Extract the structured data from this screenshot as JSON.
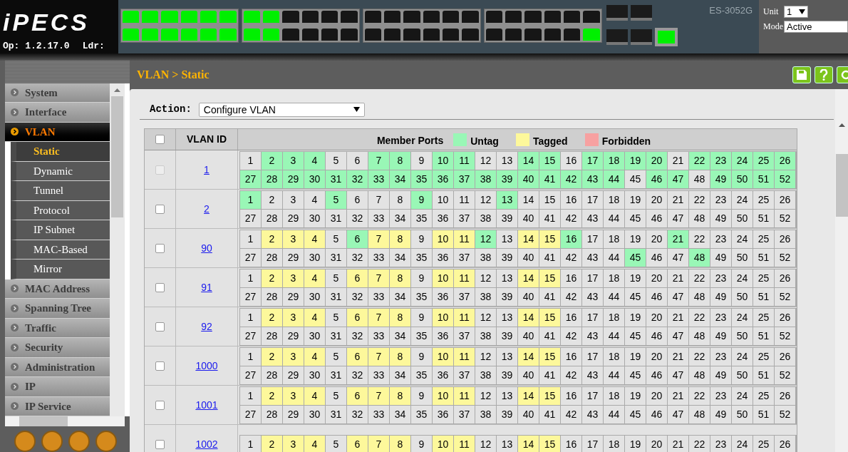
{
  "header": {
    "logo": "iPECS",
    "op_version": "Op: 1.2.17.0",
    "loader_label": "Ldr:",
    "model": "ES-3052G",
    "unit": {
      "label": "Unit",
      "value": "1"
    },
    "mode": {
      "label": "Mode",
      "value": "Active"
    },
    "panel": {
      "groups": [
        {
          "top": [
            true,
            true,
            true,
            true,
            true,
            true
          ],
          "bottom": [
            true,
            true,
            true,
            true,
            true,
            true
          ]
        },
        {
          "top": [
            true,
            true,
            false,
            false,
            false,
            false
          ],
          "bottom": [
            true,
            true,
            false,
            false,
            false,
            false
          ]
        },
        {
          "top": [
            false,
            false,
            false,
            false,
            false,
            false
          ],
          "bottom": [
            false,
            false,
            false,
            false,
            false,
            false
          ]
        },
        {
          "top": [
            false,
            false,
            false,
            false,
            false,
            false
          ],
          "bottom": [
            false,
            false,
            false,
            false,
            false,
            true
          ]
        }
      ],
      "mgmt_link": true
    }
  },
  "sidebar": {
    "items": [
      {
        "label": "System",
        "kind": "section",
        "selected": false
      },
      {
        "label": "Interface",
        "kind": "section",
        "selected": false
      },
      {
        "label": "VLAN",
        "kind": "section",
        "selected": true
      },
      {
        "label": "Static",
        "kind": "sub",
        "selected": true
      },
      {
        "label": "Dynamic",
        "kind": "sub",
        "selected": false
      },
      {
        "label": "Tunnel",
        "kind": "sub",
        "selected": false
      },
      {
        "label": "Protocol",
        "kind": "sub",
        "selected": false
      },
      {
        "label": "IP Subnet",
        "kind": "sub",
        "selected": false
      },
      {
        "label": "MAC-Based",
        "kind": "sub",
        "selected": false
      },
      {
        "label": "Mirror",
        "kind": "sub",
        "selected": false
      },
      {
        "label": "MAC Address",
        "kind": "section",
        "selected": false
      },
      {
        "label": "Spanning Tree",
        "kind": "section",
        "selected": false
      },
      {
        "label": "Traffic",
        "kind": "section",
        "selected": false
      },
      {
        "label": "Security",
        "kind": "section",
        "selected": false
      },
      {
        "label": "Administration",
        "kind": "section",
        "selected": false
      },
      {
        "label": "IP",
        "kind": "section",
        "selected": false
      },
      {
        "label": "IP Service",
        "kind": "section",
        "selected": false
      }
    ]
  },
  "breadcrumb": "VLAN > Static",
  "action": {
    "label": "Action:",
    "value": "Configure VLAN"
  },
  "table": {
    "columns": [
      "VLAN ID",
      "Member Ports"
    ],
    "select_all_checked": false,
    "legend": [
      {
        "label": "Untag",
        "color": "#99f7b6"
      },
      {
        "label": "Tagged",
        "color": "#fdf89b"
      },
      {
        "label": "Forbidden",
        "color": "#f7a1a1"
      }
    ],
    "vlans": [
      {
        "id": "1",
        "checkbox_disabled": true,
        "ports": [
          {
            "port": "1",
            "kind": "none"
          },
          {
            "port": "2",
            "kind": "untag"
          },
          {
            "port": "3",
            "kind": "untag"
          },
          {
            "port": "4",
            "kind": "untag"
          },
          {
            "port": "5",
            "kind": "none"
          },
          {
            "port": "6",
            "kind": "none"
          },
          {
            "port": "7",
            "kind": "untag"
          },
          {
            "port": "8",
            "kind": "untag"
          },
          {
            "port": "9",
            "kind": "none"
          },
          {
            "port": "10",
            "kind": "untag"
          },
          {
            "port": "11",
            "kind": "untag"
          },
          {
            "port": "12",
            "kind": "none"
          },
          {
            "port": "13",
            "kind": "none"
          },
          {
            "port": "14",
            "kind": "untag"
          },
          {
            "port": "15",
            "kind": "untag"
          },
          {
            "port": "16",
            "kind": "none"
          },
          {
            "port": "17",
            "kind": "untag"
          },
          {
            "port": "18",
            "kind": "untag"
          },
          {
            "port": "19",
            "kind": "untag"
          },
          {
            "port": "20",
            "kind": "untag"
          },
          {
            "port": "21",
            "kind": "none"
          },
          {
            "port": "22",
            "kind": "untag"
          },
          {
            "port": "23",
            "kind": "untag"
          },
          {
            "port": "24",
            "kind": "untag"
          },
          {
            "port": "25",
            "kind": "untag"
          },
          {
            "port": "26",
            "kind": "untag"
          },
          {
            "port": "27",
            "kind": "untag"
          },
          {
            "port": "28",
            "kind": "untag"
          },
          {
            "port": "29",
            "kind": "untag"
          },
          {
            "port": "30",
            "kind": "untag"
          },
          {
            "port": "31",
            "kind": "untag"
          },
          {
            "port": "32",
            "kind": "untag"
          },
          {
            "port": "33",
            "kind": "untag"
          },
          {
            "port": "34",
            "kind": "untag"
          },
          {
            "port": "35",
            "kind": "untag"
          },
          {
            "port": "36",
            "kind": "untag"
          },
          {
            "port": "37",
            "kind": "untag"
          },
          {
            "port": "38",
            "kind": "untag"
          },
          {
            "port": "39",
            "kind": "untag"
          },
          {
            "port": "40",
            "kind": "untag"
          },
          {
            "port": "41",
            "kind": "untag"
          },
          {
            "port": "42",
            "kind": "untag"
          },
          {
            "port": "43",
            "kind": "untag"
          },
          {
            "port": "44",
            "kind": "untag"
          },
          {
            "port": "45",
            "kind": "none"
          },
          {
            "port": "46",
            "kind": "untag"
          },
          {
            "port": "47",
            "kind": "untag"
          },
          {
            "port": "48",
            "kind": "none"
          },
          {
            "port": "49",
            "kind": "untag"
          },
          {
            "port": "50",
            "kind": "untag"
          },
          {
            "port": "51",
            "kind": "untag"
          },
          {
            "port": "52",
            "kind": "untag"
          }
        ]
      },
      {
        "id": "2",
        "checkbox_disabled": false,
        "ports": [
          {
            "port": "1",
            "kind": "untag"
          },
          {
            "port": "2",
            "kind": "none"
          },
          {
            "port": "3",
            "kind": "none"
          },
          {
            "port": "4",
            "kind": "none"
          },
          {
            "port": "5",
            "kind": "untag"
          },
          {
            "port": "6",
            "kind": "none"
          },
          {
            "port": "7",
            "kind": "none"
          },
          {
            "port": "8",
            "kind": "none"
          },
          {
            "port": "9",
            "kind": "untag"
          },
          {
            "port": "10",
            "kind": "none"
          },
          {
            "port": "11",
            "kind": "none"
          },
          {
            "port": "12",
            "kind": "none"
          },
          {
            "port": "13",
            "kind": "untag"
          },
          {
            "port": "14",
            "kind": "none"
          },
          {
            "port": "15",
            "kind": "none"
          },
          {
            "port": "16",
            "kind": "none"
          },
          {
            "port": "17",
            "kind": "none"
          },
          {
            "port": "18",
            "kind": "none"
          },
          {
            "port": "19",
            "kind": "none"
          },
          {
            "port": "20",
            "kind": "none"
          },
          {
            "port": "21",
            "kind": "none"
          },
          {
            "port": "22",
            "kind": "none"
          },
          {
            "port": "23",
            "kind": "none"
          },
          {
            "port": "24",
            "kind": "none"
          },
          {
            "port": "25",
            "kind": "none"
          },
          {
            "port": "26",
            "kind": "none"
          },
          {
            "port": "27",
            "kind": "none"
          },
          {
            "port": "28",
            "kind": "none"
          },
          {
            "port": "29",
            "kind": "none"
          },
          {
            "port": "30",
            "kind": "none"
          },
          {
            "port": "31",
            "kind": "none"
          },
          {
            "port": "32",
            "kind": "none"
          },
          {
            "port": "33",
            "kind": "none"
          },
          {
            "port": "34",
            "kind": "none"
          },
          {
            "port": "35",
            "kind": "none"
          },
          {
            "port": "36",
            "kind": "none"
          },
          {
            "port": "37",
            "kind": "none"
          },
          {
            "port": "38",
            "kind": "none"
          },
          {
            "port": "39",
            "kind": "none"
          },
          {
            "port": "40",
            "kind": "none"
          },
          {
            "port": "41",
            "kind": "none"
          },
          {
            "port": "42",
            "kind": "none"
          },
          {
            "port": "43",
            "kind": "none"
          },
          {
            "port": "44",
            "kind": "none"
          },
          {
            "port": "45",
            "kind": "none"
          },
          {
            "port": "46",
            "kind": "none"
          },
          {
            "port": "47",
            "kind": "none"
          },
          {
            "port": "48",
            "kind": "none"
          },
          {
            "port": "49",
            "kind": "none"
          },
          {
            "port": "50",
            "kind": "none"
          },
          {
            "port": "51",
            "kind": "none"
          },
          {
            "port": "52",
            "kind": "none"
          }
        ]
      },
      {
        "id": "90",
        "checkbox_disabled": false,
        "ports": [
          {
            "port": "1",
            "kind": "none"
          },
          {
            "port": "2",
            "kind": "tagged"
          },
          {
            "port": "3",
            "kind": "tagged"
          },
          {
            "port": "4",
            "kind": "tagged"
          },
          {
            "port": "5",
            "kind": "none"
          },
          {
            "port": "6",
            "kind": "untag"
          },
          {
            "port": "7",
            "kind": "tagged"
          },
          {
            "port": "8",
            "kind": "tagged"
          },
          {
            "port": "9",
            "kind": "none"
          },
          {
            "port": "10",
            "kind": "tagged"
          },
          {
            "port": "11",
            "kind": "tagged"
          },
          {
            "port": "12",
            "kind": "untag"
          },
          {
            "port": "13",
            "kind": "none"
          },
          {
            "port": "14",
            "kind": "tagged"
          },
          {
            "port": "15",
            "kind": "tagged"
          },
          {
            "port": "16",
            "kind": "untag"
          },
          {
            "port": "17",
            "kind": "none"
          },
          {
            "port": "18",
            "kind": "none"
          },
          {
            "port": "19",
            "kind": "none"
          },
          {
            "port": "20",
            "kind": "none"
          },
          {
            "port": "21",
            "kind": "untag"
          },
          {
            "port": "22",
            "kind": "none"
          },
          {
            "port": "23",
            "kind": "none"
          },
          {
            "port": "24",
            "kind": "none"
          },
          {
            "port": "25",
            "kind": "none"
          },
          {
            "port": "26",
            "kind": "none"
          },
          {
            "port": "27",
            "kind": "none"
          },
          {
            "port": "28",
            "kind": "none"
          },
          {
            "port": "29",
            "kind": "none"
          },
          {
            "port": "30",
            "kind": "none"
          },
          {
            "port": "31",
            "kind": "none"
          },
          {
            "port": "32",
            "kind": "none"
          },
          {
            "port": "33",
            "kind": "none"
          },
          {
            "port": "34",
            "kind": "none"
          },
          {
            "port": "35",
            "kind": "none"
          },
          {
            "port": "36",
            "kind": "none"
          },
          {
            "port": "37",
            "kind": "none"
          },
          {
            "port": "38",
            "kind": "none"
          },
          {
            "port": "39",
            "kind": "none"
          },
          {
            "port": "40",
            "kind": "none"
          },
          {
            "port": "41",
            "kind": "none"
          },
          {
            "port": "42",
            "kind": "none"
          },
          {
            "port": "43",
            "kind": "none"
          },
          {
            "port": "44",
            "kind": "none"
          },
          {
            "port": "45",
            "kind": "untag"
          },
          {
            "port": "46",
            "kind": "none"
          },
          {
            "port": "47",
            "kind": "none"
          },
          {
            "port": "48",
            "kind": "untag"
          },
          {
            "port": "49",
            "kind": "none"
          },
          {
            "port": "50",
            "kind": "none"
          },
          {
            "port": "51",
            "kind": "none"
          },
          {
            "port": "52",
            "kind": "none"
          }
        ]
      },
      {
        "id": "91",
        "checkbox_disabled": false,
        "ports": [
          {
            "port": "1",
            "kind": "none"
          },
          {
            "port": "2",
            "kind": "tagged"
          },
          {
            "port": "3",
            "kind": "tagged"
          },
          {
            "port": "4",
            "kind": "tagged"
          },
          {
            "port": "5",
            "kind": "none"
          },
          {
            "port": "6",
            "kind": "tagged"
          },
          {
            "port": "7",
            "kind": "tagged"
          },
          {
            "port": "8",
            "kind": "tagged"
          },
          {
            "port": "9",
            "kind": "none"
          },
          {
            "port": "10",
            "kind": "tagged"
          },
          {
            "port": "11",
            "kind": "tagged"
          },
          {
            "port": "12",
            "kind": "none"
          },
          {
            "port": "13",
            "kind": "none"
          },
          {
            "port": "14",
            "kind": "tagged"
          },
          {
            "port": "15",
            "kind": "tagged"
          },
          {
            "port": "16",
            "kind": "none"
          },
          {
            "port": "17",
            "kind": "none"
          },
          {
            "port": "18",
            "kind": "none"
          },
          {
            "port": "19",
            "kind": "none"
          },
          {
            "port": "20",
            "kind": "none"
          },
          {
            "port": "21",
            "kind": "none"
          },
          {
            "port": "22",
            "kind": "none"
          },
          {
            "port": "23",
            "kind": "none"
          },
          {
            "port": "24",
            "kind": "none"
          },
          {
            "port": "25",
            "kind": "none"
          },
          {
            "port": "26",
            "kind": "none"
          },
          {
            "port": "27",
            "kind": "none"
          },
          {
            "port": "28",
            "kind": "none"
          },
          {
            "port": "29",
            "kind": "none"
          },
          {
            "port": "30",
            "kind": "none"
          },
          {
            "port": "31",
            "kind": "none"
          },
          {
            "port": "32",
            "kind": "none"
          },
          {
            "port": "33",
            "kind": "none"
          },
          {
            "port": "34",
            "kind": "none"
          },
          {
            "port": "35",
            "kind": "none"
          },
          {
            "port": "36",
            "kind": "none"
          },
          {
            "port": "37",
            "kind": "none"
          },
          {
            "port": "38",
            "kind": "none"
          },
          {
            "port": "39",
            "kind": "none"
          },
          {
            "port": "40",
            "kind": "none"
          },
          {
            "port": "41",
            "kind": "none"
          },
          {
            "port": "42",
            "kind": "none"
          },
          {
            "port": "43",
            "kind": "none"
          },
          {
            "port": "44",
            "kind": "none"
          },
          {
            "port": "45",
            "kind": "none"
          },
          {
            "port": "46",
            "kind": "none"
          },
          {
            "port": "47",
            "kind": "none"
          },
          {
            "port": "48",
            "kind": "none"
          },
          {
            "port": "49",
            "kind": "none"
          },
          {
            "port": "50",
            "kind": "none"
          },
          {
            "port": "51",
            "kind": "none"
          },
          {
            "port": "52",
            "kind": "none"
          }
        ]
      },
      {
        "id": "92",
        "checkbox_disabled": false,
        "ports": [
          {
            "port": "1",
            "kind": "none"
          },
          {
            "port": "2",
            "kind": "tagged"
          },
          {
            "port": "3",
            "kind": "tagged"
          },
          {
            "port": "4",
            "kind": "tagged"
          },
          {
            "port": "5",
            "kind": "none"
          },
          {
            "port": "6",
            "kind": "tagged"
          },
          {
            "port": "7",
            "kind": "tagged"
          },
          {
            "port": "8",
            "kind": "tagged"
          },
          {
            "port": "9",
            "kind": "none"
          },
          {
            "port": "10",
            "kind": "tagged"
          },
          {
            "port": "11",
            "kind": "tagged"
          },
          {
            "port": "12",
            "kind": "none"
          },
          {
            "port": "13",
            "kind": "none"
          },
          {
            "port": "14",
            "kind": "tagged"
          },
          {
            "port": "15",
            "kind": "tagged"
          },
          {
            "port": "16",
            "kind": "none"
          },
          {
            "port": "17",
            "kind": "none"
          },
          {
            "port": "18",
            "kind": "none"
          },
          {
            "port": "19",
            "kind": "none"
          },
          {
            "port": "20",
            "kind": "none"
          },
          {
            "port": "21",
            "kind": "none"
          },
          {
            "port": "22",
            "kind": "none"
          },
          {
            "port": "23",
            "kind": "none"
          },
          {
            "port": "24",
            "kind": "none"
          },
          {
            "port": "25",
            "kind": "none"
          },
          {
            "port": "26",
            "kind": "none"
          },
          {
            "port": "27",
            "kind": "none"
          },
          {
            "port": "28",
            "kind": "none"
          },
          {
            "port": "29",
            "kind": "none"
          },
          {
            "port": "30",
            "kind": "none"
          },
          {
            "port": "31",
            "kind": "none"
          },
          {
            "port": "32",
            "kind": "none"
          },
          {
            "port": "33",
            "kind": "none"
          },
          {
            "port": "34",
            "kind": "none"
          },
          {
            "port": "35",
            "kind": "none"
          },
          {
            "port": "36",
            "kind": "none"
          },
          {
            "port": "37",
            "kind": "none"
          },
          {
            "port": "38",
            "kind": "none"
          },
          {
            "port": "39",
            "kind": "none"
          },
          {
            "port": "40",
            "kind": "none"
          },
          {
            "port": "41",
            "kind": "none"
          },
          {
            "port": "42",
            "kind": "none"
          },
          {
            "port": "43",
            "kind": "none"
          },
          {
            "port": "44",
            "kind": "none"
          },
          {
            "port": "45",
            "kind": "none"
          },
          {
            "port": "46",
            "kind": "none"
          },
          {
            "port": "47",
            "kind": "none"
          },
          {
            "port": "48",
            "kind": "none"
          },
          {
            "port": "49",
            "kind": "none"
          },
          {
            "port": "50",
            "kind": "none"
          },
          {
            "port": "51",
            "kind": "none"
          },
          {
            "port": "52",
            "kind": "none"
          }
        ]
      },
      {
        "id": "1000",
        "checkbox_disabled": false,
        "ports": [
          {
            "port": "1",
            "kind": "none"
          },
          {
            "port": "2",
            "kind": "tagged"
          },
          {
            "port": "3",
            "kind": "tagged"
          },
          {
            "port": "4",
            "kind": "tagged"
          },
          {
            "port": "5",
            "kind": "none"
          },
          {
            "port": "6",
            "kind": "tagged"
          },
          {
            "port": "7",
            "kind": "tagged"
          },
          {
            "port": "8",
            "kind": "tagged"
          },
          {
            "port": "9",
            "kind": "none"
          },
          {
            "port": "10",
            "kind": "tagged"
          },
          {
            "port": "11",
            "kind": "tagged"
          },
          {
            "port": "12",
            "kind": "none"
          },
          {
            "port": "13",
            "kind": "none"
          },
          {
            "port": "14",
            "kind": "tagged"
          },
          {
            "port": "15",
            "kind": "tagged"
          },
          {
            "port": "16",
            "kind": "none"
          },
          {
            "port": "17",
            "kind": "none"
          },
          {
            "port": "18",
            "kind": "none"
          },
          {
            "port": "19",
            "kind": "none"
          },
          {
            "port": "20",
            "kind": "none"
          },
          {
            "port": "21",
            "kind": "none"
          },
          {
            "port": "22",
            "kind": "none"
          },
          {
            "port": "23",
            "kind": "none"
          },
          {
            "port": "24",
            "kind": "none"
          },
          {
            "port": "25",
            "kind": "none"
          },
          {
            "port": "26",
            "kind": "none"
          },
          {
            "port": "27",
            "kind": "none"
          },
          {
            "port": "28",
            "kind": "none"
          },
          {
            "port": "29",
            "kind": "none"
          },
          {
            "port": "30",
            "kind": "none"
          },
          {
            "port": "31",
            "kind": "none"
          },
          {
            "port": "32",
            "kind": "none"
          },
          {
            "port": "33",
            "kind": "none"
          },
          {
            "port": "34",
            "kind": "none"
          },
          {
            "port": "35",
            "kind": "none"
          },
          {
            "port": "36",
            "kind": "none"
          },
          {
            "port": "37",
            "kind": "none"
          },
          {
            "port": "38",
            "kind": "none"
          },
          {
            "port": "39",
            "kind": "none"
          },
          {
            "port": "40",
            "kind": "none"
          },
          {
            "port": "41",
            "kind": "none"
          },
          {
            "port": "42",
            "kind": "none"
          },
          {
            "port": "43",
            "kind": "none"
          },
          {
            "port": "44",
            "kind": "none"
          },
          {
            "port": "45",
            "kind": "none"
          },
          {
            "port": "46",
            "kind": "none"
          },
          {
            "port": "47",
            "kind": "none"
          },
          {
            "port": "48",
            "kind": "none"
          },
          {
            "port": "49",
            "kind": "none"
          },
          {
            "port": "50",
            "kind": "none"
          },
          {
            "port": "51",
            "kind": "none"
          },
          {
            "port": "52",
            "kind": "none"
          }
        ]
      },
      {
        "id": "1001",
        "checkbox_disabled": false,
        "ports": [
          {
            "port": "1",
            "kind": "none"
          },
          {
            "port": "2",
            "kind": "tagged"
          },
          {
            "port": "3",
            "kind": "tagged"
          },
          {
            "port": "4",
            "kind": "tagged"
          },
          {
            "port": "5",
            "kind": "none"
          },
          {
            "port": "6",
            "kind": "tagged"
          },
          {
            "port": "7",
            "kind": "tagged"
          },
          {
            "port": "8",
            "kind": "tagged"
          },
          {
            "port": "9",
            "kind": "none"
          },
          {
            "port": "10",
            "kind": "tagged"
          },
          {
            "port": "11",
            "kind": "tagged"
          },
          {
            "port": "12",
            "kind": "none"
          },
          {
            "port": "13",
            "kind": "none"
          },
          {
            "port": "14",
            "kind": "tagged"
          },
          {
            "port": "15",
            "kind": "tagged"
          },
          {
            "port": "16",
            "kind": "none"
          },
          {
            "port": "17",
            "kind": "none"
          },
          {
            "port": "18",
            "kind": "none"
          },
          {
            "port": "19",
            "kind": "none"
          },
          {
            "port": "20",
            "kind": "none"
          },
          {
            "port": "21",
            "kind": "none"
          },
          {
            "port": "22",
            "kind": "none"
          },
          {
            "port": "23",
            "kind": "none"
          },
          {
            "port": "24",
            "kind": "none"
          },
          {
            "port": "25",
            "kind": "none"
          },
          {
            "port": "26",
            "kind": "none"
          },
          {
            "port": "27",
            "kind": "none"
          },
          {
            "port": "28",
            "kind": "none"
          },
          {
            "port": "29",
            "kind": "none"
          },
          {
            "port": "30",
            "kind": "none"
          },
          {
            "port": "31",
            "kind": "none"
          },
          {
            "port": "32",
            "kind": "none"
          },
          {
            "port": "33",
            "kind": "none"
          },
          {
            "port": "34",
            "kind": "none"
          },
          {
            "port": "35",
            "kind": "none"
          },
          {
            "port": "36",
            "kind": "none"
          },
          {
            "port": "37",
            "kind": "none"
          },
          {
            "port": "38",
            "kind": "none"
          },
          {
            "port": "39",
            "kind": "none"
          },
          {
            "port": "40",
            "kind": "none"
          },
          {
            "port": "41",
            "kind": "none"
          },
          {
            "port": "42",
            "kind": "none"
          },
          {
            "port": "43",
            "kind": "none"
          },
          {
            "port": "44",
            "kind": "none"
          },
          {
            "port": "45",
            "kind": "none"
          },
          {
            "port": "46",
            "kind": "none"
          },
          {
            "port": "47",
            "kind": "none"
          },
          {
            "port": "48",
            "kind": "none"
          },
          {
            "port": "49",
            "kind": "none"
          },
          {
            "port": "50",
            "kind": "none"
          },
          {
            "port": "51",
            "kind": "none"
          },
          {
            "port": "52",
            "kind": "none"
          }
        ]
      },
      {
        "id": "1002",
        "checkbox_disabled": false,
        "ports": [
          {
            "port": "1",
            "kind": "none"
          },
          {
            "port": "2",
            "kind": "tagged"
          },
          {
            "port": "3",
            "kind": "tagged"
          },
          {
            "port": "4",
            "kind": "tagged"
          },
          {
            "port": "5",
            "kind": "none"
          },
          {
            "port": "6",
            "kind": "tagged"
          },
          {
            "port": "7",
            "kind": "tagged"
          },
          {
            "port": "8",
            "kind": "tagged"
          },
          {
            "port": "9",
            "kind": "none"
          },
          {
            "port": "10",
            "kind": "tagged"
          },
          {
            "port": "11",
            "kind": "tagged"
          },
          {
            "port": "12",
            "kind": "none"
          },
          {
            "port": "13",
            "kind": "none"
          },
          {
            "port": "14",
            "kind": "tagged"
          },
          {
            "port": "15",
            "kind": "tagged"
          },
          {
            "port": "16",
            "kind": "none"
          },
          {
            "port": "17",
            "kind": "none"
          },
          {
            "port": "18",
            "kind": "none"
          },
          {
            "port": "19",
            "kind": "none"
          },
          {
            "port": "20",
            "kind": "none"
          },
          {
            "port": "21",
            "kind": "none"
          },
          {
            "port": "22",
            "kind": "none"
          },
          {
            "port": "23",
            "kind": "none"
          },
          {
            "port": "24",
            "kind": "none"
          },
          {
            "port": "25",
            "kind": "none"
          },
          {
            "port": "26",
            "kind": "none"
          }
        ]
      }
    ]
  }
}
